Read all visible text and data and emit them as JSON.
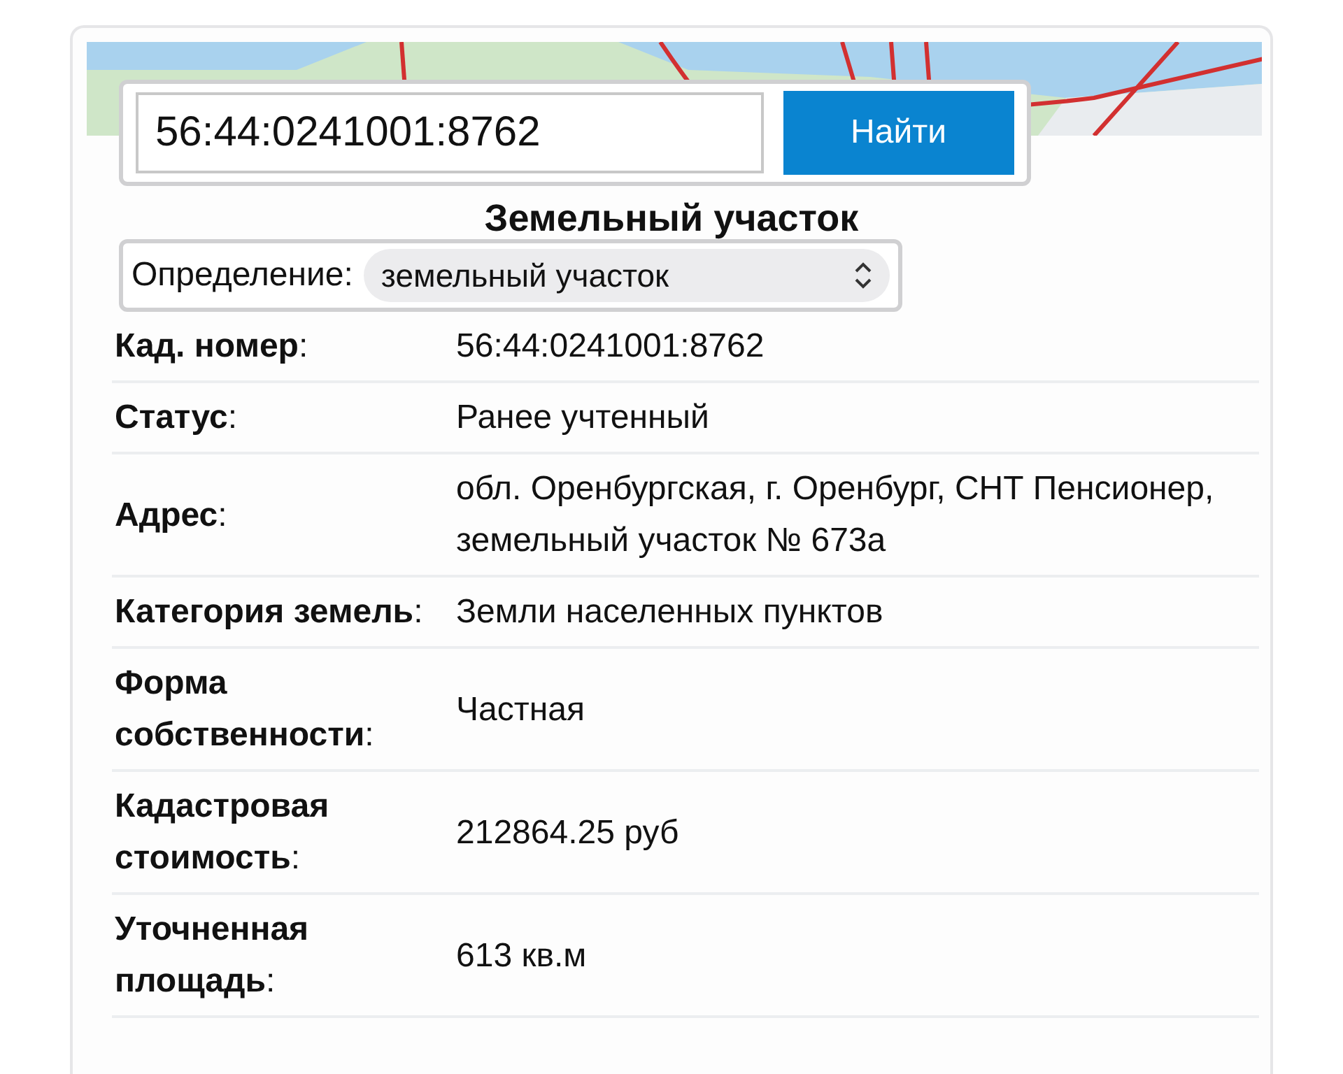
{
  "search": {
    "value": "56:44:0241001:8762",
    "button": "Найти"
  },
  "title": "Земельный участок",
  "definition": {
    "label": "Определение:",
    "value": "земельный участок"
  },
  "rows": [
    {
      "label": "**Кад. номер**:",
      "value": "56:44:0241001:8762"
    },
    {
      "label": "**Статус**:",
      "value": "Ранее учтенный"
    },
    {
      "label": "**Адрес**:",
      "value": "обл. Оренбургская, г. Оренбург, СНТ Пенсионер, земельный участок № 673а"
    },
    {
      "label": "**Категория земель**:",
      "value": "Земли населенных пунктов"
    },
    {
      "label": "**Форма собственности**:",
      "value": "Частная"
    },
    {
      "label": "**Кадастровая стоимость**:",
      "value": "212864.25 руб"
    },
    {
      "label": "**Уточненная площадь**:",
      "value": "613 кв.м"
    }
  ]
}
